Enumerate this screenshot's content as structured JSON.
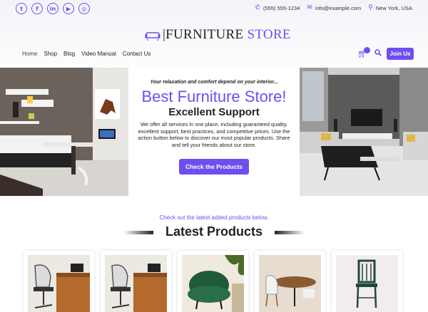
{
  "header": {
    "social": [
      {
        "icon": "twitter-icon",
        "glyph": "t"
      },
      {
        "icon": "facebook-icon",
        "glyph": "f"
      },
      {
        "icon": "linkedin-icon",
        "glyph": "in"
      },
      {
        "icon": "youtube-icon",
        "glyph": "▶"
      },
      {
        "icon": "instagram-icon",
        "glyph": "◎"
      }
    ],
    "phone": "(555) 555-1234",
    "email": "info@example.com",
    "location": "New York, USA"
  },
  "logo": {
    "part1": "FURNITURE",
    "part2": "STORE"
  },
  "nav": {
    "items": [
      "Home",
      "Shop",
      "Blog",
      "Video Manual",
      "Contact Us"
    ],
    "active": "Home"
  },
  "actions": {
    "join_label": "Join Us"
  },
  "hero": {
    "tagline": "Your relaxation and comfort depend on your interior...",
    "title": "Best Furniture Store!",
    "subtitle": "Excellent Support",
    "description": "We offer all services in one place, including guaranteed quality, excellent support, best practices, and competitive prices. Use the action button below to discover our most popular products. Share and tell your friends about our store.",
    "button_label": "Check the Products"
  },
  "latest": {
    "subtitle": "Check out the latest added products below.",
    "title": "Latest Products"
  },
  "colors": {
    "accent": "#6e4ef0"
  }
}
